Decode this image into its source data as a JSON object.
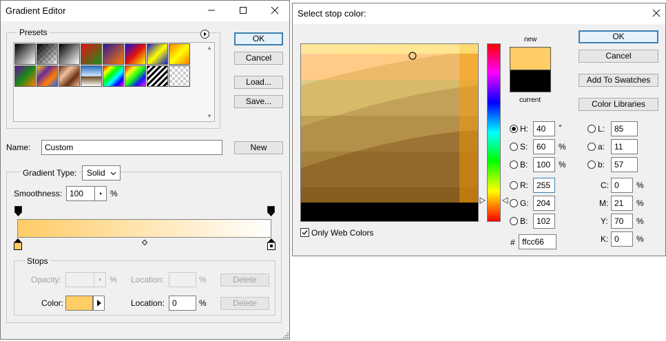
{
  "gradient_editor": {
    "title": "Gradient Editor",
    "presets_label": "Presets",
    "ok": "OK",
    "cancel": "Cancel",
    "load": "Load...",
    "save": "Save...",
    "name_label": "Name:",
    "name_value": "Custom",
    "new_label": "New",
    "gradient_type_label": "Gradient Type:",
    "gradient_type_value": "Solid",
    "smoothness_label": "Smoothness:",
    "smoothness_value": "100",
    "percent": "%",
    "stops_label": "Stops",
    "opacity_label": "Opacity:",
    "location_label": "Location:",
    "delete_label": "Delete",
    "color_label": "Color:",
    "color_location_value": "0",
    "start_color": "#ffcc66",
    "end_color": "#ffffff"
  },
  "color_picker": {
    "title": "Select stop color:",
    "ok": "OK",
    "cancel": "Cancel",
    "add_to_swatches": "Add To Swatches",
    "color_libraries": "Color Libraries",
    "new_label": "new",
    "current_label": "current",
    "new_color": "#ffcc66",
    "current_color": "#000000",
    "only_web_colors": "Only Web Colors",
    "only_web_colors_checked": true,
    "degree": "°",
    "hsb": [
      {
        "label": "H:",
        "value": "40",
        "unit": "°",
        "selected": true
      },
      {
        "label": "S:",
        "value": "60",
        "unit": "%",
        "selected": false
      },
      {
        "label": "B:",
        "value": "100",
        "unit": "%",
        "selected": false
      }
    ],
    "rgb": [
      {
        "label": "R:",
        "value": "255"
      },
      {
        "label": "G:",
        "value": "204"
      },
      {
        "label": "B:",
        "value": "102"
      }
    ],
    "lab": [
      {
        "label": "L:",
        "value": "85"
      },
      {
        "label": "a:",
        "value": "11"
      },
      {
        "label": "b:",
        "value": "57"
      }
    ],
    "cmyk": [
      {
        "label": "C:",
        "value": "0",
        "unit": "%"
      },
      {
        "label": "M:",
        "value": "21",
        "unit": "%"
      },
      {
        "label": "Y:",
        "value": "70",
        "unit": "%"
      },
      {
        "label": "K:",
        "value": "0",
        "unit": "%"
      }
    ],
    "hex_label": "#",
    "hex_value": "ffcc66"
  }
}
